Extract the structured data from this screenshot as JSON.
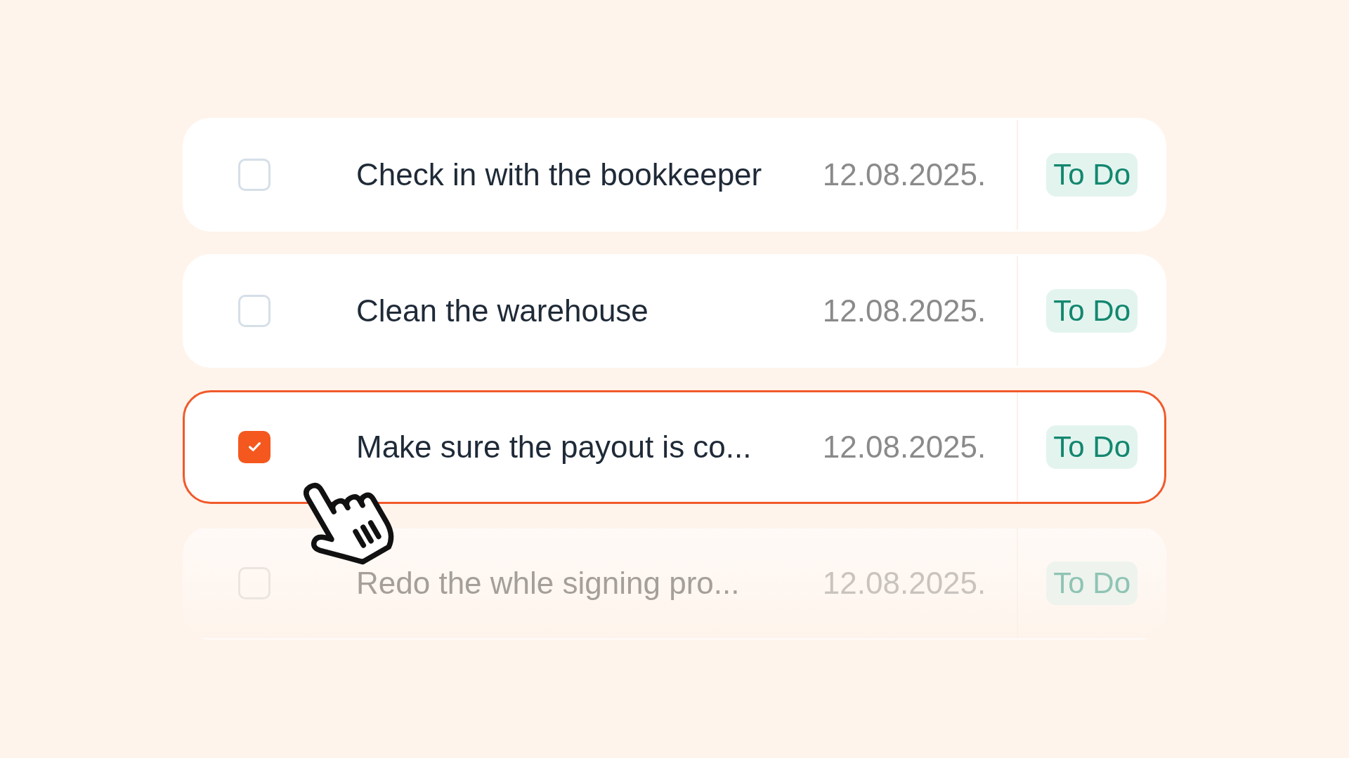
{
  "rows": [
    {
      "task": "Check in with the bookkeeper",
      "date": "12.08.2025.",
      "status": "To Do",
      "checked": false,
      "selected": false,
      "faded": false
    },
    {
      "task": "Clean the warehouse",
      "date": "12.08.2025.",
      "status": "To Do",
      "checked": false,
      "selected": false,
      "faded": false
    },
    {
      "task": "Make sure the payout is co...",
      "date": "12.08.2025.",
      "status": "To Do",
      "checked": true,
      "selected": true,
      "faded": false
    },
    {
      "task": "Redo the whle signing pro...",
      "date": "12.08.2025.",
      "status": "To Do",
      "checked": false,
      "selected": false,
      "faded": true
    }
  ]
}
